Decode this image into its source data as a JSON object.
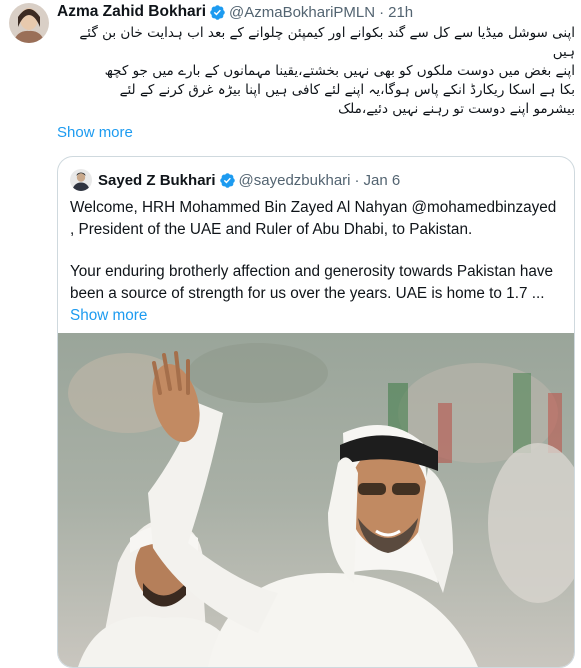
{
  "tweet": {
    "author_name": "Azma Zahid Bokhari",
    "handle": "@AzmaBokhariPMLN",
    "separator": "·",
    "time": "21h",
    "text_lines": [
      "اپنی سوشل میڈیا سے کل سے گند بکوانے اور کیمپئن چلوانے کے بعد اب ہدایت خان بن گئے",
      "ہیں",
      "اپنے بغض میں دوست ملکوں کو بھی نہیں بخشتے،یقینا مہمانوں کے بارے میں جو کچھ",
      "بکا ہے اسکا ریکارڈ انکے پاس ہوگا،یہ اپنے لئے کافی ہیں اپنا بیڑہ غرق کرنے کے لئے",
      "بیشرمو اپنے دوست تو رہنے نہیں دئیے،ملک"
    ],
    "show_more": "Show more"
  },
  "quote": {
    "author_name": "Sayed Z Bukhari",
    "handle": "@sayedzbukhari",
    "separator": "·",
    "time": "Jan 6",
    "paragraph1": "Welcome, HRH Mohammed Bin Zayed Al Nahyan @mohamedbinzayed , President of the UAE and Ruler of Abu Dhabi, to Pakistan.",
    "paragraph2": "Your enduring brotherly affection and generosity towards Pakistan have been a source of strength for us over the years. UAE is home to 1.7 ...",
    "show_more": "Show more"
  },
  "colors": {
    "link": "#1d9bf0",
    "secondary_text": "#536471",
    "verified": "#1d9bf0",
    "border": "#cfd9de"
  },
  "icons": {
    "verified": "verified-badge-icon"
  }
}
